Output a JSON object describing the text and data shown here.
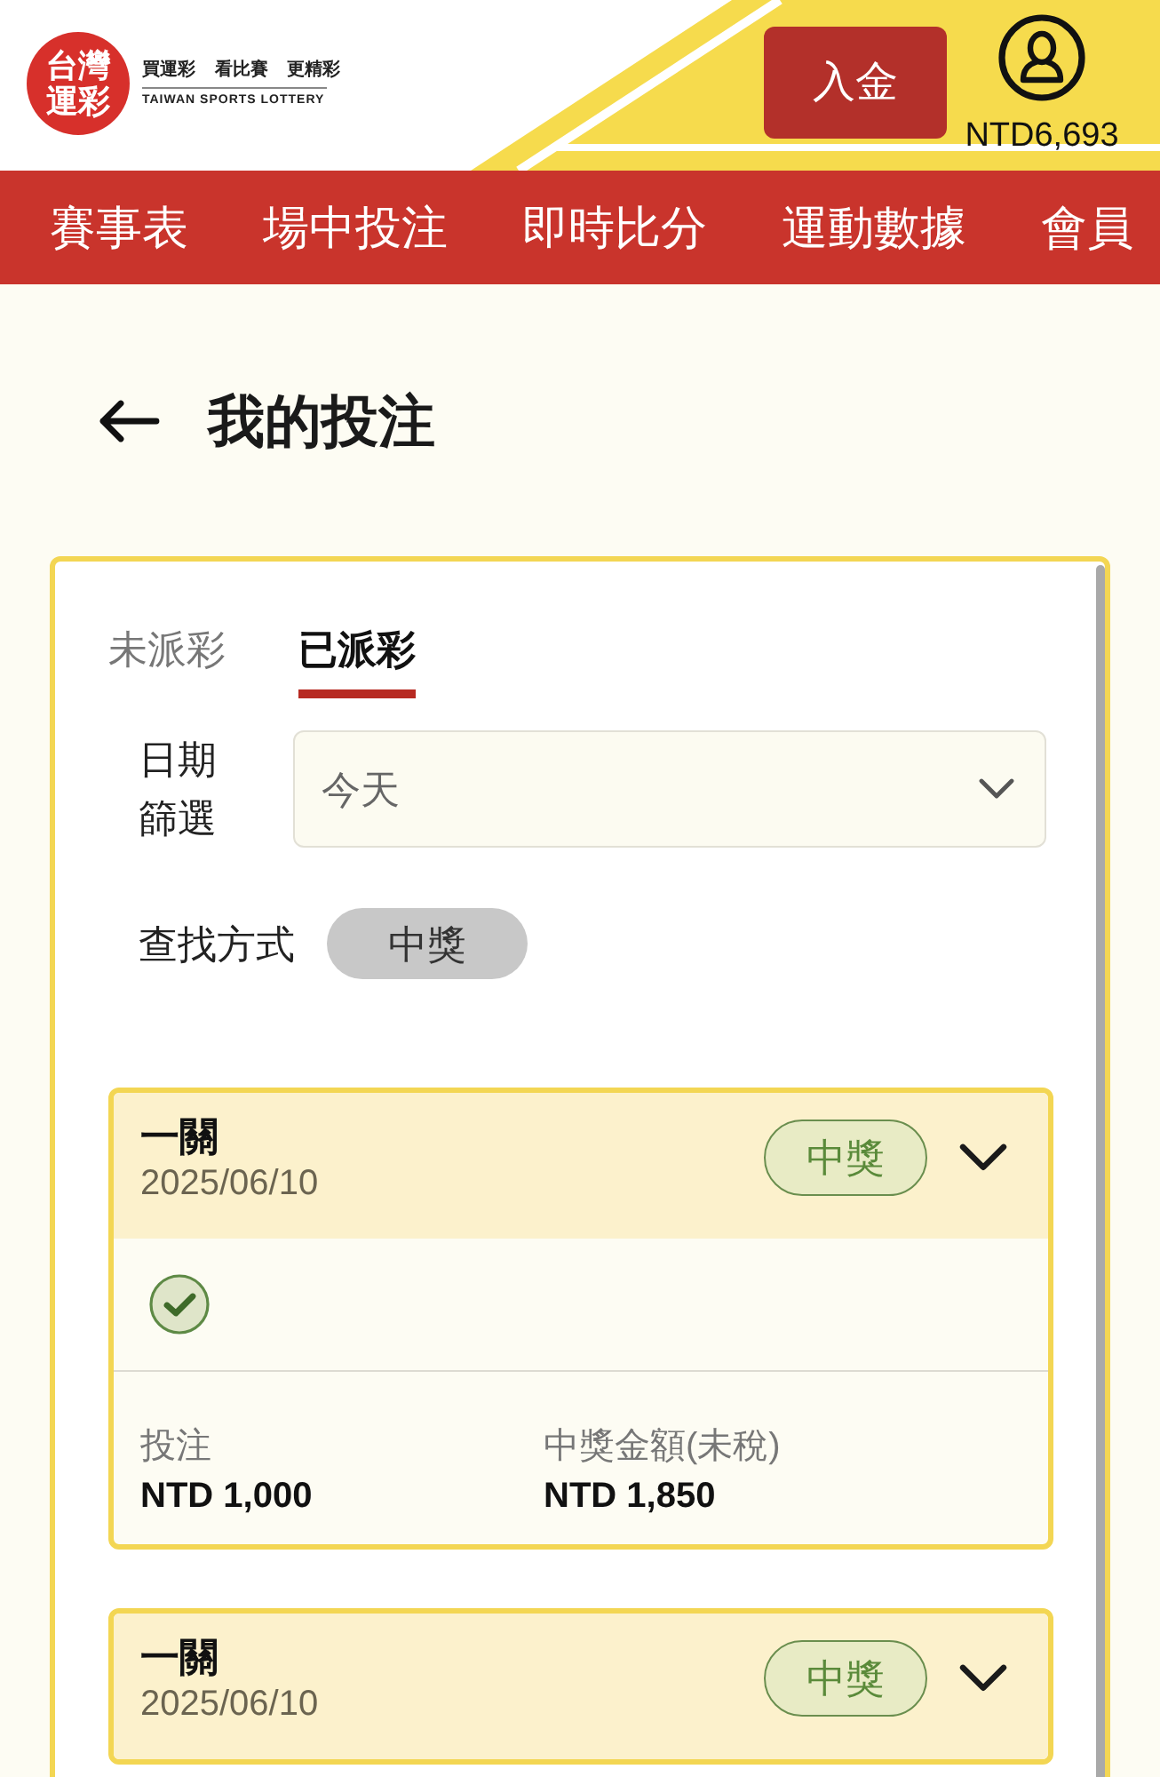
{
  "header": {
    "logo_text": "台灣運彩",
    "slogan": "買運彩 看比賽 更精彩",
    "tagline": "TAIWAN SPORTS LOTTERY",
    "deposit_button": "入金",
    "balance": "NTD6,693"
  },
  "nav": [
    {
      "label": "賽事表"
    },
    {
      "label": "場中投注"
    },
    {
      "label": "即時比分"
    },
    {
      "label": "運動數據"
    },
    {
      "label": "會員"
    }
  ],
  "page": {
    "title": "我的投注"
  },
  "tabs": [
    {
      "label": "未派彩",
      "selected": false
    },
    {
      "label": "已派彩",
      "selected": true
    }
  ],
  "date_filter": {
    "label": "日期篩選",
    "value": "今天"
  },
  "search_mode": {
    "label": "查找方式",
    "chips": [
      {
        "label": "中獎",
        "selected": true
      }
    ]
  },
  "bets": [
    {
      "title": "一關",
      "date": "2025/06/10",
      "status": "中獎",
      "legs": [
        {
          "kind": "won"
        }
      ],
      "stake_label": "投注",
      "stake": "NTD 1,000",
      "payout_label": "中獎金額(未稅)",
      "payout": "NTD 1,850"
    },
    {
      "title": "一關",
      "date": "2025/06/10",
      "status": "中獎"
    }
  ]
}
